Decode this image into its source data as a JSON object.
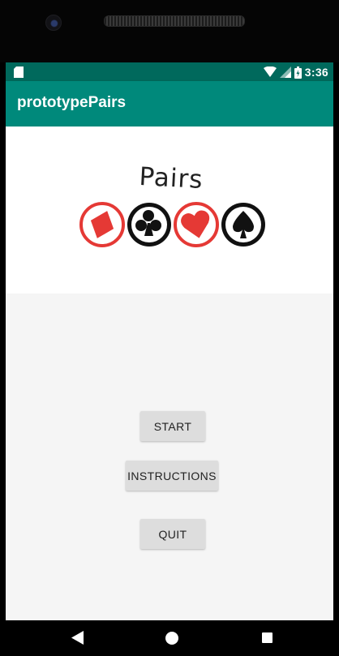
{
  "status_bar": {
    "time": "3:36",
    "icons": [
      "sd-card-icon",
      "wifi-icon",
      "signal-icon",
      "battery-icon"
    ]
  },
  "app_bar": {
    "title": "prototypePairs"
  },
  "logo": {
    "title": "Pairs",
    "suits": [
      "diamond",
      "club",
      "heart",
      "spade"
    ],
    "colors": {
      "red": "#e53935",
      "black": "#111111"
    }
  },
  "menu": {
    "start_label": "START",
    "instructions_label": "INSTRUCTIONS",
    "quit_label": "QUIT"
  },
  "colors": {
    "status_bar": "#00695c",
    "app_bar": "#00897b",
    "button": "#dddddd"
  },
  "nav_bar": {
    "icons": [
      "back-icon",
      "home-icon",
      "recents-icon"
    ]
  }
}
